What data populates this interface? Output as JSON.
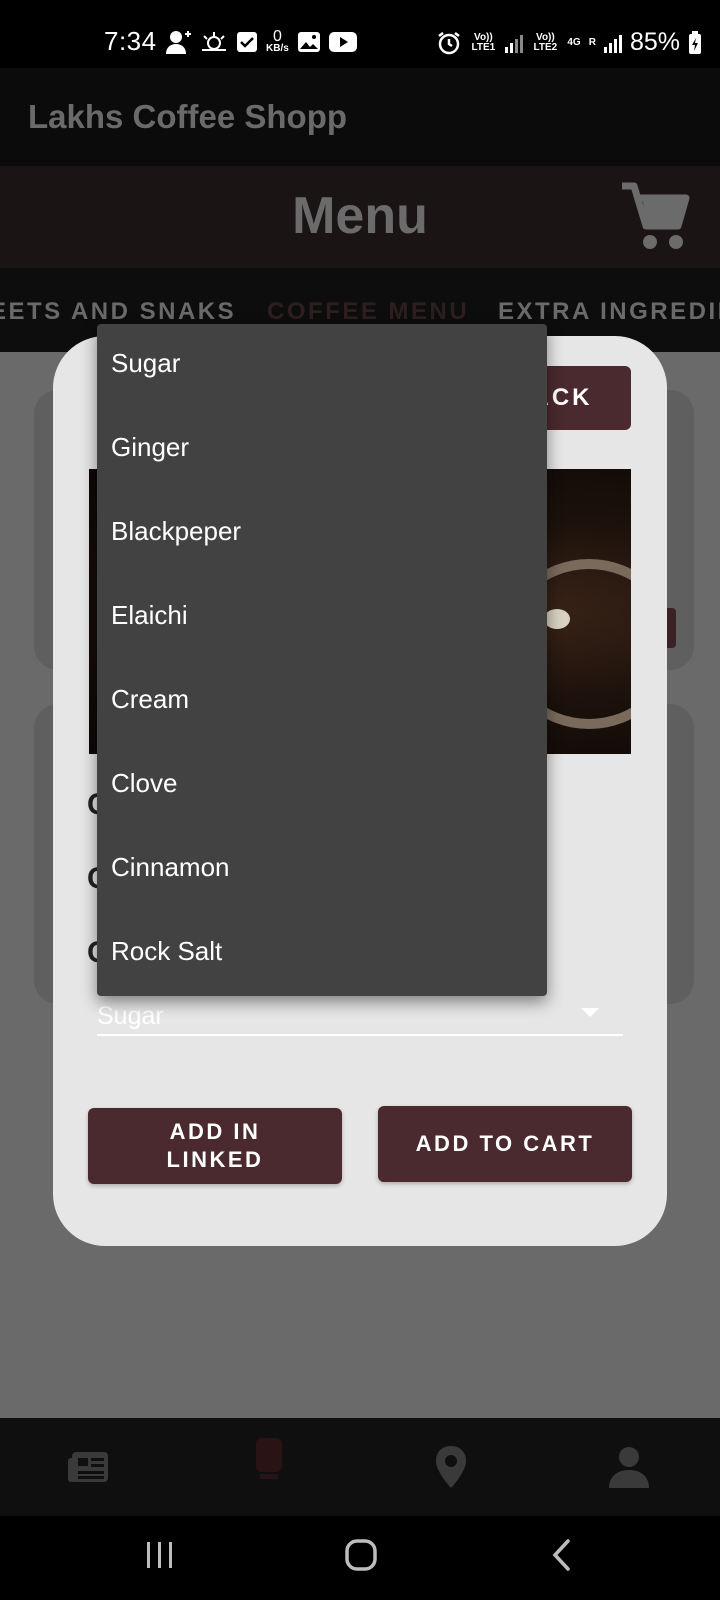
{
  "status_bar": {
    "time": "7:34",
    "net_speed_value": "0",
    "net_speed_unit": "KB/s",
    "sim1_label": "Vo)) LTE1",
    "sim2_label": "Vo)) LTE2",
    "net_type": "4G",
    "roaming": "R",
    "battery": "85%"
  },
  "app_bar": {
    "title": "Lakhs Coffee Shopp"
  },
  "menu_header": {
    "title": "Menu"
  },
  "tabs": [
    "EETS AND SNAKS",
    "COFFEE MENU",
    "EXTRA INGREDIE"
  ],
  "modal": {
    "back_label": "ACK",
    "option_letters": [
      "C",
      "C",
      "C"
    ],
    "select_value": "Sugar",
    "add_linked_label": "ADD IN\nLINKED",
    "add_to_cart_label": "ADD TO CART"
  },
  "dropdown": {
    "items": [
      "Sugar",
      "Ginger",
      "Blackpeper",
      "Elaichi",
      "Cream",
      "Clove",
      "Cinnamon",
      "Rock Salt"
    ]
  },
  "bottom_nav": {
    "items": [
      "news-icon",
      "coffee-icon",
      "location-icon",
      "profile-icon"
    ]
  },
  "colors": {
    "accent": "#4a2a2e",
    "dropdown_bg": "#424242",
    "modal_bg": "#e6e6e6",
    "scrim": "#6a6a6a"
  }
}
